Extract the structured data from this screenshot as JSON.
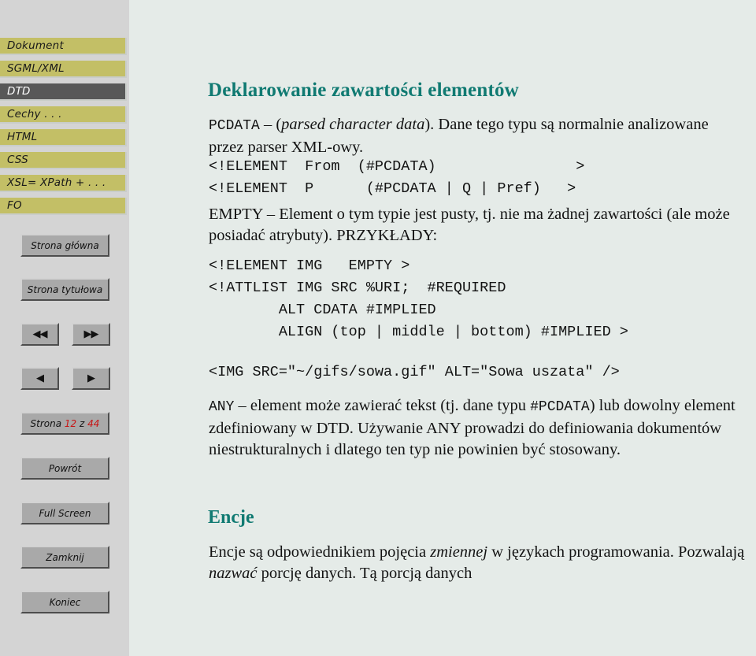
{
  "sidebar": {
    "nav_items": [
      {
        "label": "Dokument",
        "active": false
      },
      {
        "label": "SGML/XML",
        "active": false
      },
      {
        "label": "DTD",
        "active": true
      },
      {
        "label": "Cechy . . .",
        "active": false
      },
      {
        "label": "HTML",
        "active": false
      },
      {
        "label": "CSS",
        "active": false
      },
      {
        "label": "XSL= XPath + . . .",
        "active": false
      },
      {
        "label": "FO",
        "active": false
      }
    ],
    "buttons": {
      "home": "Strona główna",
      "title_page": "Strona tytułowa",
      "first": "◀◀",
      "last": "▶▶",
      "prev": "◀",
      "next": "▶",
      "page_prefix": "Strona",
      "page_current": "12",
      "page_of": "z",
      "page_total": "44",
      "back": "Powrót",
      "full_screen": "Full Screen",
      "close": "Zamknij",
      "quit": "Koniec"
    }
  },
  "main": {
    "title": "Deklarowanie zawartości elementów",
    "pcdata": {
      "term": "PCDATA",
      "dash": " – (",
      "italic": "parsed character data",
      "rest": "). Dane tego typu są normalnie analizowane przez parser XML-owy."
    },
    "code1": "<!ELEMENT  From  (#PCDATA)                >\n<!ELEMENT  P      (#PCDATA | Q | Pref)   >",
    "empty_para": "EMPTY – Element o tym typie jest pusty, tj. nie ma żadnej zawartości (ale może posiadać atrybuty). PRZYKŁADY:",
    "code2": "<!ELEMENT IMG   EMPTY >\n<!ATTLIST IMG SRC %URI;  #REQUIRED\n        ALT CDATA #IMPLIED\n        ALIGN (top | middle | bottom) #IMPLIED >",
    "code3": "<IMG SRC=\"~/gifs/sowa.gif\" ALT=\"Sowa uszata\" />",
    "any_para": {
      "term": "ANY",
      "mid": " – element może zawierać tekst (tj. dane typu ",
      "mono2": "#PCDATA",
      "rest": ") lub dowolny element zdefiniowany w DTD. Używanie ANY prowadzi do definiowania dokumentów niestrukturalnych i dlatego ten typ nie powinien być stosowany."
    },
    "section_title": "Encje",
    "encje_para": {
      "p1": "Encje są odpowiednikiem pojęcia ",
      "i1": "zmiennej",
      "p2": " w językach programowania. Pozwalają ",
      "i2": "nazwać",
      "p3": " porcję danych. Tą porcją danych"
    }
  },
  "colors": {
    "sidebar_bg": "#d4d4d4",
    "content_bg": "#e5ebe8",
    "nav_item": "#c3bf66",
    "nav_active": "#585858",
    "heading": "#107a72",
    "page_number": "#c81414",
    "button": "#a9a9a9"
  }
}
